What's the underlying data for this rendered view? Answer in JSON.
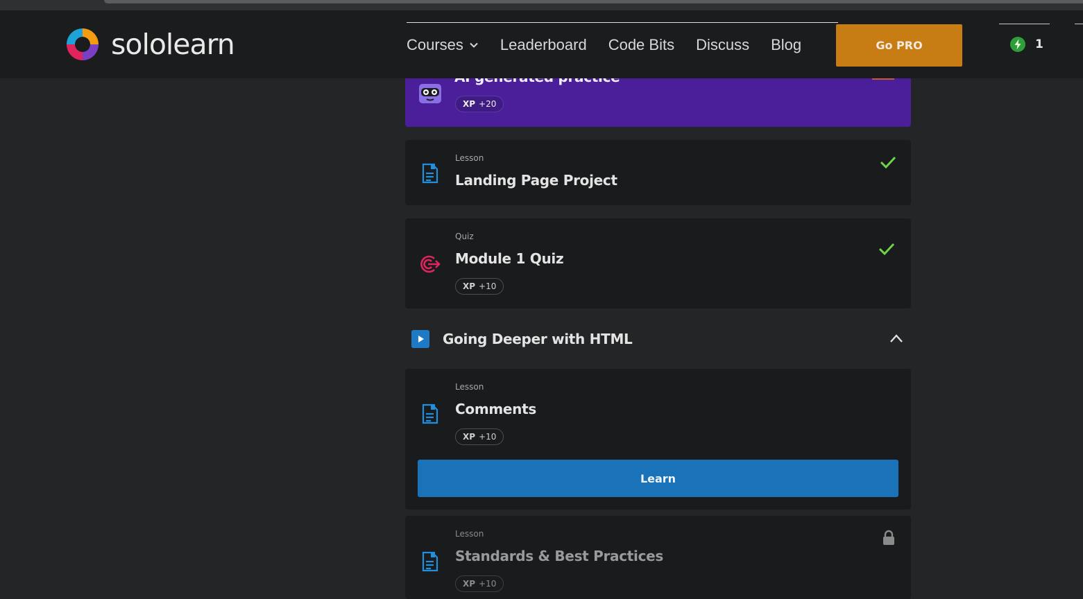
{
  "brand": {
    "name": "sololearn"
  },
  "nav": {
    "items": [
      {
        "label": "Courses",
        "has_dropdown": true
      },
      {
        "label": "Leaderboard"
      },
      {
        "label": "Code Bits"
      },
      {
        "label": "Discuss"
      },
      {
        "label": "Blog"
      }
    ],
    "cta": "Go PRO",
    "streak_count": "1"
  },
  "colors": {
    "accent_orange": "#c77d14",
    "accent_blue": "#1a73b8",
    "ai_purple": "#4b1f99",
    "check_green": "#6fd44a",
    "quiz_red": "#e0245e"
  },
  "ai_card": {
    "title": "AI generated practice",
    "xp_label": "XP",
    "xp_value": "+20",
    "icon": "robot-face-icon"
  },
  "lessons": [
    {
      "kind": "Lesson",
      "title": "Landing Page Project",
      "status": "completed",
      "icon": "lesson-doc-icon"
    },
    {
      "kind": "Quiz",
      "title": "Module 1 Quiz",
      "xp_label": "XP",
      "xp_value": "+10",
      "status": "completed",
      "icon": "target-icon"
    }
  ],
  "section": {
    "title": "Going Deeper with HTML",
    "expanded": true
  },
  "section_lessons": [
    {
      "kind": "Lesson",
      "title": "Comments",
      "xp_label": "XP",
      "xp_value": "+10",
      "status": "current",
      "action": "Learn"
    },
    {
      "kind": "Lesson",
      "title": "Standards & Best Practices",
      "xp_label": "XP",
      "xp_value": "+10",
      "status": "locked"
    }
  ]
}
